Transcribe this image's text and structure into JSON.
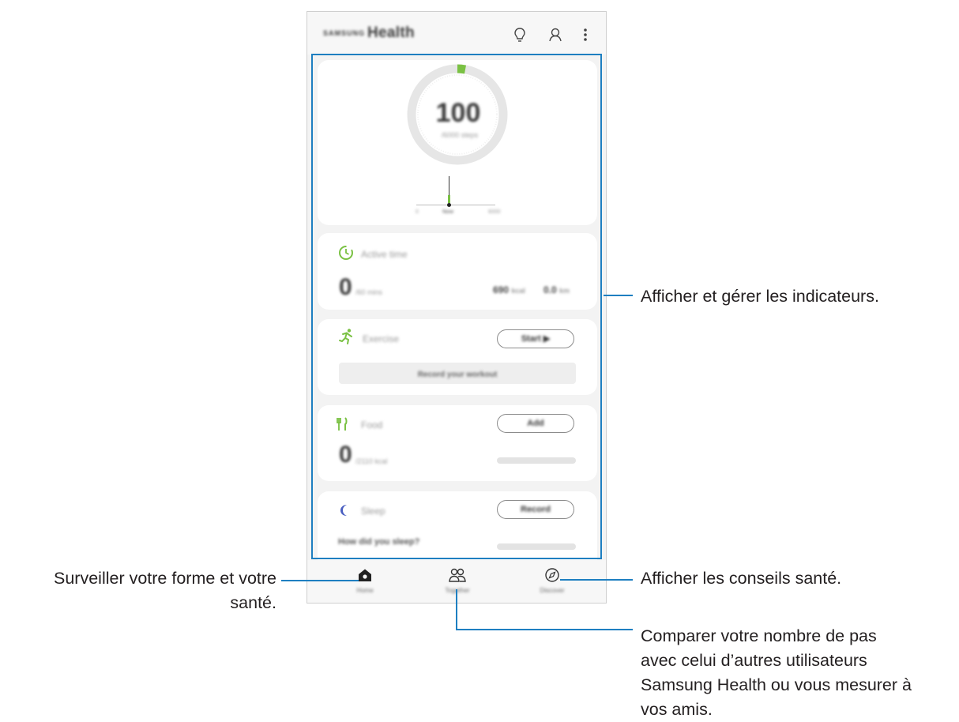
{
  "app": {
    "brand": "SAMSUNG",
    "title": "Health"
  },
  "steps": {
    "count": "100",
    "target": "/6000 steps",
    "graph_labels": [
      "0",
      "Now",
      "6000"
    ]
  },
  "active_time": {
    "title": "Active time",
    "value": "0",
    "target": "/60 mins",
    "kcal_value": "690",
    "kcal_unit": "kcal",
    "distance_value": "0.0",
    "distance_unit": "km"
  },
  "exercise": {
    "title": "Exercise",
    "start_label": "Start ▶",
    "record_label": "Record your workout"
  },
  "food": {
    "title": "Food",
    "add_label": "Add",
    "value": "0",
    "target": "/2110 kcal"
  },
  "sleep": {
    "title": "Sleep",
    "record_label": "Record",
    "question": "How did you sleep?"
  },
  "nav": {
    "home": "Home",
    "together": "Together",
    "discover": "Discover"
  },
  "callouts": {
    "indicators": "Afficher et gérer les indicateurs.",
    "monitor_line1": "Surveiller votre forme et votre",
    "monitor_line2": "santé.",
    "tips": "Afficher les conseils santé.",
    "compare_line1": "Comparer votre nombre de pas",
    "compare_line2": "avec celui d’autres utilisateurs",
    "compare_line3": "Samsung Health ou vous mesurer à",
    "compare_line4": "vos amis."
  },
  "colors": {
    "callout_line": "#1e7fc1",
    "accent_green": "#7ac143",
    "sleep_moon": "#4a5fc1"
  },
  "icons": [
    "lightbulb-icon",
    "person-icon",
    "more-options-icon",
    "timer-icon",
    "running-icon",
    "fork-knife-icon",
    "moon-icon",
    "home-icon",
    "together-icon",
    "compass-icon"
  ]
}
